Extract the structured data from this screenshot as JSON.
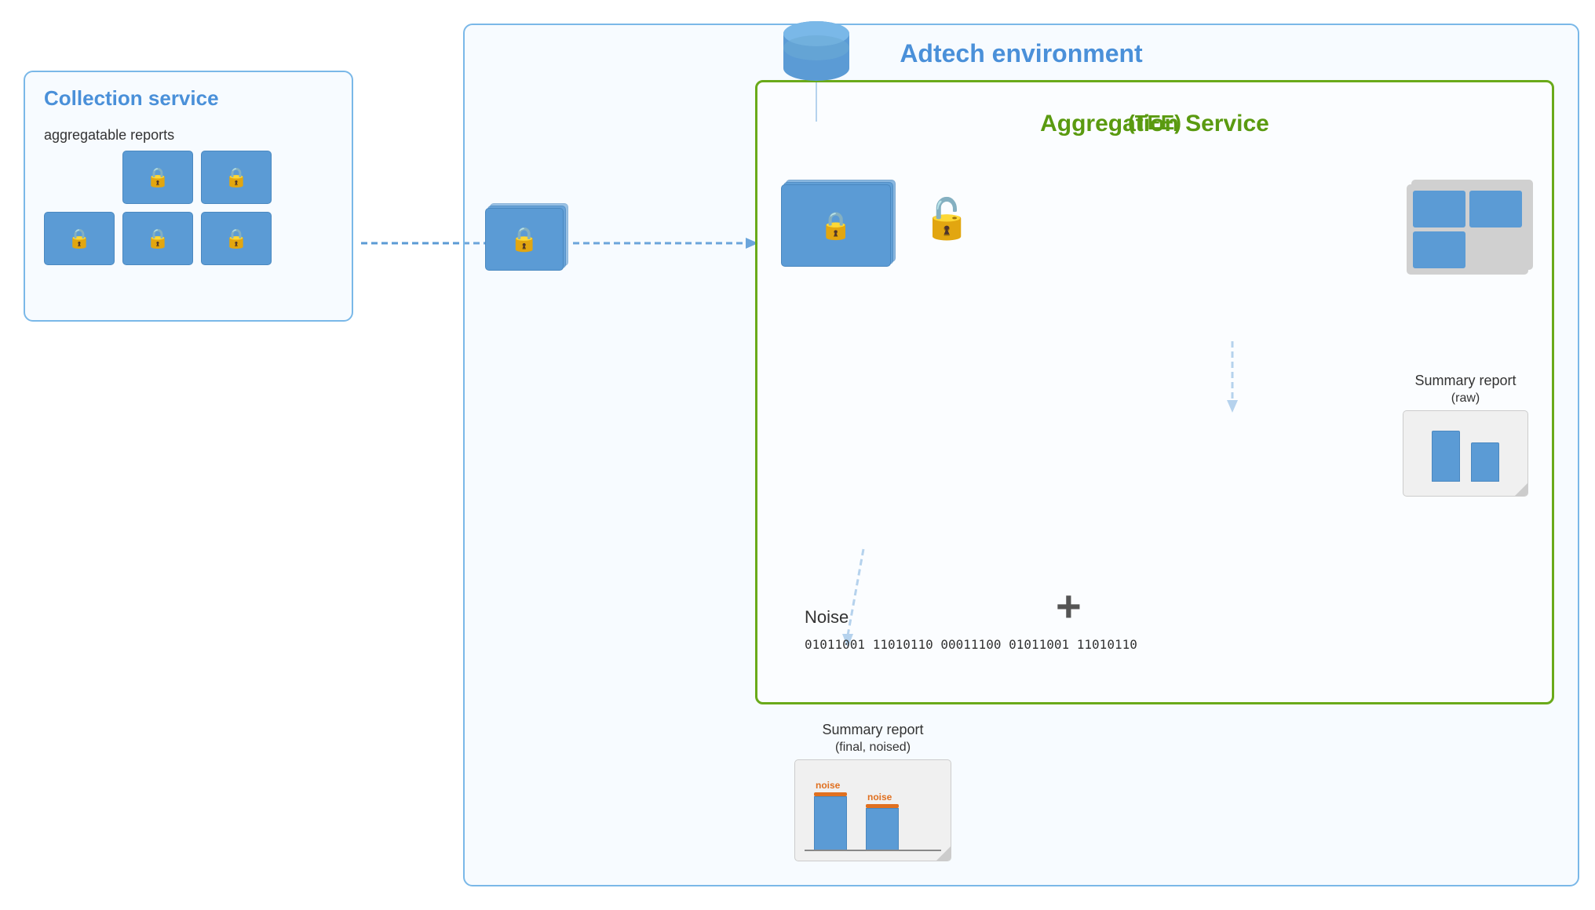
{
  "adtech": {
    "env_label": "Adtech environment",
    "agg_service_label": "Aggregation Service",
    "agg_service_sublabel": "(TEE)"
  },
  "collection": {
    "title": "Collection service",
    "sublabel": "aggregatable reports"
  },
  "noise": {
    "label": "Noise",
    "data": "01011001\n11010110\n00011100\n01011001\n11010110"
  },
  "summary_raw": {
    "label": "Summary report",
    "sublabel": "(raw)"
  },
  "summary_final": {
    "label": "Summary report",
    "sublabel": "(final, noised)"
  },
  "noise_bar_labels": [
    "noise",
    "noise"
  ],
  "lock_emoji": "🔒",
  "unlock_emoji": "🔓",
  "plus_sign": "+",
  "colors": {
    "blue_border": "#7ab8e8",
    "green_border": "#6aaa1a",
    "blue_card": "#5b9bd5",
    "noise_orange": "#e07020"
  }
}
